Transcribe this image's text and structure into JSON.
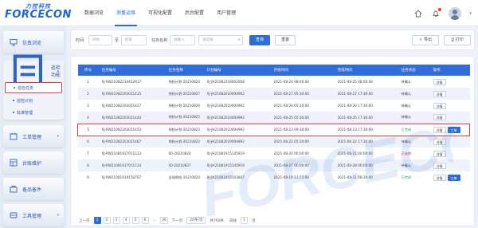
{
  "brand": {
    "cn": "力控科技",
    "en": "FORCECON"
  },
  "nav": {
    "items": [
      {
        "label": "数据浏览",
        "active": false
      },
      {
        "label": "测量运维",
        "active": true
      },
      {
        "label": "可视化配置",
        "active": false
      },
      {
        "label": "后台配置",
        "active": false
      },
      {
        "label": "用户管理",
        "active": false
      }
    ]
  },
  "header_icons": [
    "home-icon",
    "bell-icon",
    "avatar",
    "chevron-down-icon"
  ],
  "sidebar": {
    "items": [
      {
        "label": "仿真浏览",
        "icon": "monitor-icon"
      },
      {
        "label": "巡检功能",
        "icon": "inspection-icon",
        "expanded": true,
        "children": [
          {
            "label": "巡检任务",
            "active": true
          },
          {
            "label": "巡检计划",
            "active": false
          },
          {
            "label": "标准管理",
            "active": false
          }
        ]
      },
      {
        "label": "工单管理",
        "icon": "workorder-icon"
      },
      {
        "label": "台账维护",
        "icon": "ledger-icon"
      },
      {
        "label": "备品备件",
        "icon": "spareparts-icon"
      },
      {
        "label": "工具管理",
        "icon": "tools-icon"
      }
    ]
  },
  "filter": {
    "time_label": "时间:",
    "start_placeholder": "开始",
    "end_placeholder": "结束",
    "range_sep": "至",
    "task_label": "任务名称:",
    "task_placeholder": "请输入",
    "status_placeholder": "请选择",
    "query_label": "查询",
    "reset_label": "重置",
    "export_label": "导出",
    "print_label": "打印"
  },
  "table": {
    "columns": [
      "序号",
      "任务编号",
      "任务名称",
      "计划编号",
      "开始时间",
      "完成时间",
      "任务状态",
      "操作"
    ],
    "rows": [
      {
        "no": "1",
        "task_no": "XJ-RW21082214452917",
        "name": "例检计划-20210824",
        "plan_no": "XJ-JH21082316602008",
        "start": "2021-08-24 08:00:00",
        "end": "2021-08-25 08:00:00",
        "status": "待确认",
        "status_type": "normal",
        "ops": [
          "详情"
        ]
      },
      {
        "no": "2",
        "task_no": "XJ-RW21082203021415",
        "name": "例检计划-20210827",
        "plan_no": "XJ-JH21082010094992",
        "start": "2021-08-27 05:30:00",
        "end": "2021-08-27 17:30:00",
        "status": "待确认",
        "status_type": "normal",
        "ops": [
          "详情"
        ]
      },
      {
        "no": "3",
        "task_no": "XJ-RW21082203021427",
        "name": "例检计划-20210826",
        "plan_no": "XJ-JH21082010094992",
        "start": "2021-08-26 05:30:00",
        "end": "2021-08-26 17:30:00",
        "status": "待确认",
        "status_type": "normal",
        "ops": [
          "详情"
        ]
      },
      {
        "no": "4",
        "task_no": "XJ-RW21082203021443",
        "name": "例检计划-20210825",
        "plan_no": "XJ-JH21082010094992",
        "start": "2021-08-25 05:30:00",
        "end": "2021-08-25 17:30:00",
        "status": "待确认",
        "status_type": "normal",
        "ops": [
          "详情"
        ]
      },
      {
        "no": "5",
        "task_no": "XJ-RW21082203021453",
        "name": "例检计划-20210823",
        "plan_no": "XJ-JH21082010094992",
        "start": "2021-08-23 09:30:00",
        "end": "2021-08-23 17:30:00",
        "status": "已完成",
        "status_type": "green",
        "ops": [
          "详情",
          "工单"
        ],
        "highlight": true
      },
      {
        "no": "6",
        "task_no": "XJ-RW21082203021467",
        "name": "例检计划-20210822",
        "plan_no": "XJ-JH21082010094992",
        "start": "2021-08-22 05:30:00",
        "end": "2021-08-22 17:30:00",
        "status": "待确认",
        "status_type": "normal",
        "ops": [
          "详情"
        ]
      },
      {
        "no": "7",
        "task_no": "XJ-RW21081917011123",
        "name": "00-20210820",
        "plan_no": "XJ-JH21081915145919",
        "start": "2021-08-20 00:00:00",
        "end": "2021-08-21 00:00:00",
        "status": "已逾期",
        "status_type": "red",
        "ops": [
          "详情"
        ]
      },
      {
        "no": "8",
        "task_no": "XJ-RW21081917011124",
        "name": "00-20210827",
        "plan_no": "XJ-JH21081915145919",
        "start": "2021-08-27 00:00:00",
        "end": "2021-08-28 00:00:00",
        "status": "待确认",
        "status_type": "normal",
        "ops": [
          "详情"
        ]
      },
      {
        "no": "9",
        "task_no": "XJ-RW21081919150767",
        "name": "全场例检-20210820",
        "plan_no": "XJ-JH21081915103847",
        "start": "2021-08-19 11:13:00",
        "end": "2021-08-21 08:30:00",
        "status": "已完成",
        "status_type": "green",
        "ops": [
          "详情",
          "工单"
        ]
      }
    ]
  },
  "pagination": {
    "prev": "上一页",
    "pages": [
      "1",
      "2",
      "3",
      "4",
      "5",
      "6",
      "…",
      "36"
    ],
    "active_page": "1",
    "next": "下一页",
    "page_size": "20条/页",
    "total": "共760条",
    "goto_label": "前往",
    "goto_value": "1",
    "page_unit": "页"
  },
  "colors": {
    "primary": "#2b6fd6",
    "header": "#2e6ddb",
    "success": "#19a35a",
    "danger": "#e03b3b"
  }
}
